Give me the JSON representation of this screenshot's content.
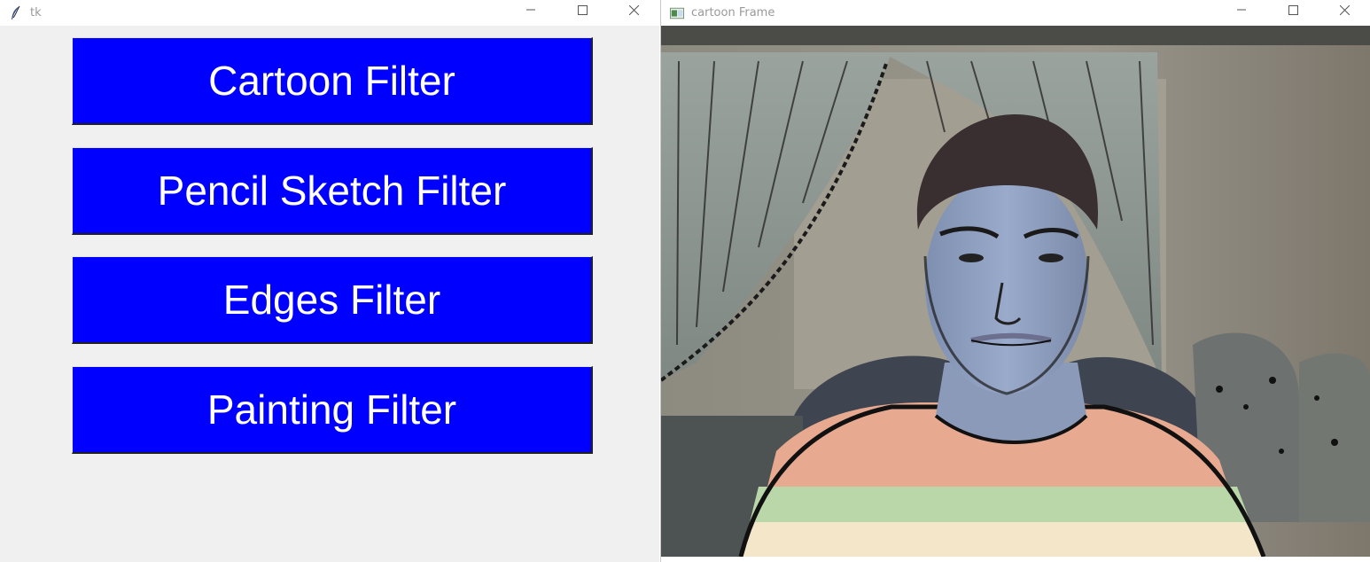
{
  "tk_window": {
    "title": "tk",
    "icon": "feather-icon",
    "controls": [
      "minimize-icon",
      "maximize-icon",
      "close-icon"
    ],
    "buttons": [
      {
        "label": "Cartoon Filter"
      },
      {
        "label": "Pencil Sketch Filter"
      },
      {
        "label": "Edges Filter"
      },
      {
        "label": "Painting Filter"
      }
    ],
    "button_color": "#0000ff",
    "button_text_color": "#ffffff",
    "background_color": "#f0f0f0"
  },
  "cv_window": {
    "title": "cartoon Frame",
    "icon": "opencv-window-icon",
    "controls": [
      "minimize-icon",
      "maximize-icon",
      "close-icon"
    ],
    "content": "webcam-frame-cartoon-filtered"
  }
}
